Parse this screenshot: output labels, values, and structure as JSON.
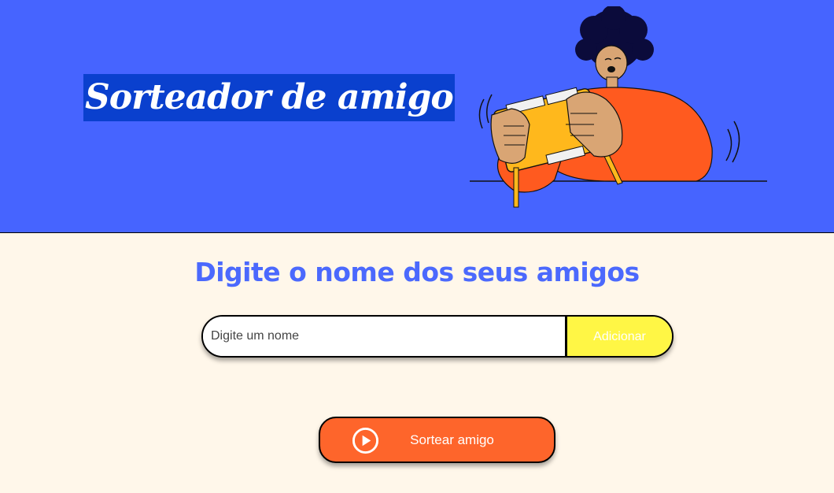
{
  "header": {
    "title": "Sorteador de amigo",
    "background_color": "#4664FF",
    "title_highlight_color": "#0A40CE",
    "illustration": "person-holding-box-illustration"
  },
  "main": {
    "subtitle": "Digite o nome dos seus amigos",
    "name_input": {
      "placeholder": "Digite um nome",
      "value": ""
    },
    "add_button_label": "Adicionar",
    "draw_button_label": "Sortear amigo",
    "draw_button_icon": "play-circle-icon"
  },
  "colors": {
    "page_background": "#FFF7EA",
    "subtitle": "#4B69FD",
    "add_button": "#FFF645",
    "draw_button": "#FE652B"
  }
}
